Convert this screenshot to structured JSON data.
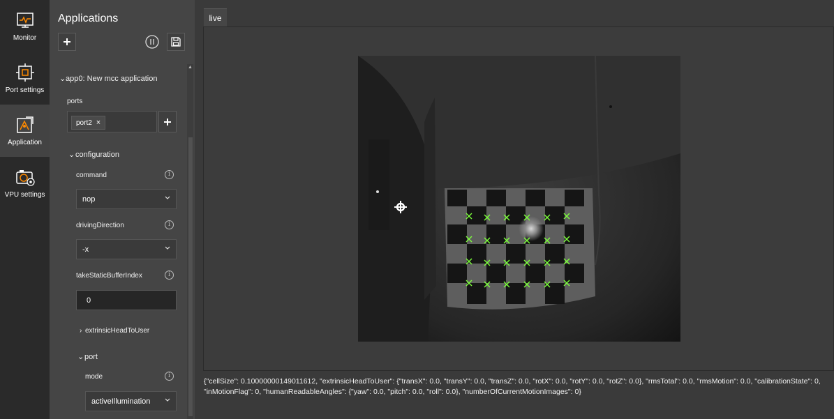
{
  "rail": {
    "items": [
      {
        "label": "Monitor",
        "icon": "monitor-icon"
      },
      {
        "label": "Port settings",
        "icon": "port-settings-icon"
      },
      {
        "label": "Application",
        "icon": "application-icon"
      },
      {
        "label": "VPU settings",
        "icon": "vpu-settings-icon"
      }
    ],
    "active": "Application"
  },
  "panel": {
    "title": "Applications",
    "app_node": "app0: New mcc application",
    "ports_label": "ports",
    "port_chip": "port2",
    "configuration": "configuration",
    "fields": {
      "command": {
        "label": "command",
        "value": "nop"
      },
      "driving_direction": {
        "label": "drivingDirection",
        "value": "-x"
      },
      "take_static_buffer_index": {
        "label": "takeStaticBufferIndex",
        "value": "0"
      },
      "extrinsic_head_to_user": "extrinsicHeadToUser",
      "port_node": "port",
      "mode": {
        "label": "mode",
        "value": "activeIllumination"
      }
    }
  },
  "tabs": {
    "live": "live"
  },
  "output": {
    "text": "{\"cellSize\": 0.10000000149011612, \"extrinsicHeadToUser\": {\"transX\": 0.0, \"transY\": 0.0, \"transZ\": 0.0, \"rotX\": 0.0, \"rotY\": 0.0, \"rotZ\": 0.0}, \"rmsTotal\": 0.0, \"rmsMotion\": 0.0, \"calibrationState\": 0, \"inMotionFlag\": 0, \"humanReadableAngles\": {\"yaw\": 0.0, \"pitch\": 0.0, \"roll\": 0.0}, \"numberOfCurrentMotionImages\": 0}"
  },
  "colors": {
    "accent_marker": "#7cff3a",
    "rail_bg": "#2a2a2a",
    "panel_bg": "#454545",
    "main_bg": "#3a3a3a"
  }
}
